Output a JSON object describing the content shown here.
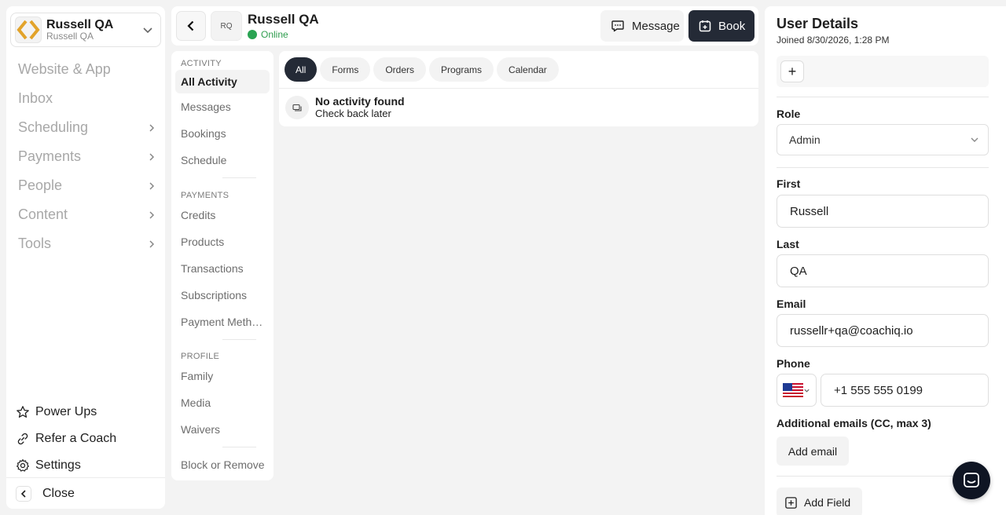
{
  "org": {
    "name": "Russell QA",
    "sub": "Russell QA"
  },
  "nav": [
    {
      "label": "Website & App",
      "has_children": false
    },
    {
      "label": "Inbox",
      "has_children": false
    },
    {
      "label": "Scheduling",
      "has_children": true
    },
    {
      "label": "Payments",
      "has_children": true
    },
    {
      "label": "People",
      "has_children": true
    },
    {
      "label": "Content",
      "has_children": true
    },
    {
      "label": "Tools",
      "has_children": true
    }
  ],
  "utility": {
    "power_ups": "Power Ups",
    "refer": "Refer a Coach",
    "settings": "Settings",
    "close": "Close"
  },
  "header": {
    "avatar_initials": "RQ",
    "name": "Russell QA",
    "status": "Online",
    "message_label": "Message",
    "book_label": "Book"
  },
  "subnav": {
    "activity_heading": "ACTIVITY",
    "activity_items": [
      "All Activity",
      "Messages",
      "Bookings",
      "Schedule"
    ],
    "payments_heading": "PAYMENTS",
    "payments_items": [
      "Credits",
      "Products",
      "Transactions",
      "Subscriptions",
      "Payment Meth…"
    ],
    "profile_heading": "PROFILE",
    "profile_items": [
      "Family",
      "Media",
      "Waivers"
    ],
    "block_label": "Block or Remove"
  },
  "activity": {
    "filters": [
      "All",
      "Forms",
      "Orders",
      "Programs",
      "Calendar"
    ],
    "empty_title": "No activity found",
    "empty_sub": "Check back later"
  },
  "details": {
    "title": "User Details",
    "joined": "Joined 8/30/2026, 1:28 PM",
    "add_tag": "+",
    "role_label": "Role",
    "role_value": "Admin",
    "first_label": "First",
    "first_value": "Russell",
    "last_label": "Last",
    "last_value": "QA",
    "email_label": "Email",
    "email_value": "russellr+qa@coachiq.io",
    "phone_label": "Phone",
    "phone_value": "+1 555 555 0199",
    "additional_label": "Additional emails (CC, max 3)",
    "add_email": "Add email",
    "add_field": "Add Field"
  },
  "colors": {
    "accent_dark": "#242a36",
    "online_green": "#2aa352",
    "logo_gold": "#e2a32a"
  }
}
